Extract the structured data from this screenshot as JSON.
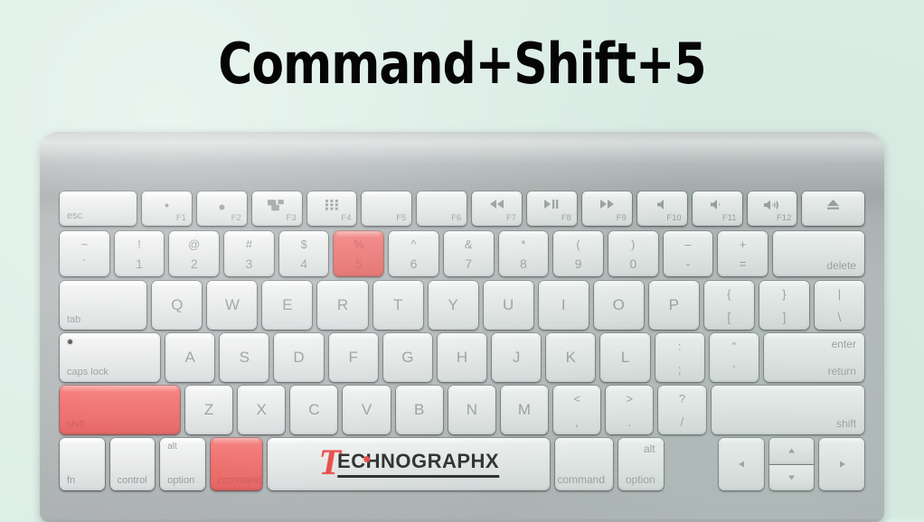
{
  "page": {
    "title": "Command+Shift+5",
    "background_color": "#dceee6",
    "highlight_color": "#ee6361"
  },
  "keyboard": {
    "brand_logo": {
      "lead_letter": "T",
      "text": "ECHNOGRAPHX"
    },
    "rows": {
      "function_row": [
        {
          "name": "esc",
          "label": "esc",
          "icon": "",
          "fkey": ""
        },
        {
          "name": "f1",
          "label": "",
          "icon": "brightness-down-icon",
          "fkey": "F1"
        },
        {
          "name": "f2",
          "label": "",
          "icon": "brightness-up-icon",
          "fkey": "F2"
        },
        {
          "name": "f3",
          "label": "",
          "icon": "mission-control-icon",
          "fkey": "F3"
        },
        {
          "name": "f4",
          "label": "",
          "icon": "launchpad-icon",
          "fkey": "F4"
        },
        {
          "name": "f5",
          "label": "",
          "icon": "",
          "fkey": "F5"
        },
        {
          "name": "f6",
          "label": "",
          "icon": "",
          "fkey": "F6"
        },
        {
          "name": "f7",
          "label": "",
          "icon": "rewind-icon",
          "fkey": "F7"
        },
        {
          "name": "f8",
          "label": "",
          "icon": "play-pause-icon",
          "fkey": "F8"
        },
        {
          "name": "f9",
          "label": "",
          "icon": "fast-forward-icon",
          "fkey": "F9"
        },
        {
          "name": "f10",
          "label": "",
          "icon": "mute-icon",
          "fkey": "F10"
        },
        {
          "name": "f11",
          "label": "",
          "icon": "volume-down-icon",
          "fkey": "F11"
        },
        {
          "name": "f12",
          "label": "",
          "icon": "volume-up-icon",
          "fkey": "F12"
        },
        {
          "name": "eject",
          "label": "",
          "icon": "eject-icon",
          "fkey": ""
        }
      ],
      "number_row": [
        {
          "name": "backtick",
          "upper": "~",
          "lower": "`",
          "highlight": false
        },
        {
          "name": "one",
          "upper": "!",
          "lower": "1",
          "highlight": false
        },
        {
          "name": "two",
          "upper": "@",
          "lower": "2",
          "highlight": false
        },
        {
          "name": "three",
          "upper": "#",
          "lower": "3",
          "highlight": false
        },
        {
          "name": "four",
          "upper": "$",
          "lower": "4",
          "highlight": false
        },
        {
          "name": "five",
          "upper": "%",
          "lower": "5",
          "highlight": true
        },
        {
          "name": "six",
          "upper": "^",
          "lower": "6",
          "highlight": false
        },
        {
          "name": "seven",
          "upper": "&",
          "lower": "7",
          "highlight": false
        },
        {
          "name": "eight",
          "upper": "*",
          "lower": "8",
          "highlight": false
        },
        {
          "name": "nine",
          "upper": "(",
          "lower": "9",
          "highlight": false
        },
        {
          "name": "zero",
          "upper": ")",
          "lower": "0",
          "highlight": false
        },
        {
          "name": "minus",
          "upper": "–",
          "lower": "-",
          "highlight": false
        },
        {
          "name": "equals",
          "upper": "+",
          "lower": "=",
          "highlight": false
        },
        {
          "name": "delete",
          "label": "delete",
          "highlight": false
        }
      ],
      "top_letter_row": {
        "tab": "tab",
        "letters": [
          "Q",
          "W",
          "E",
          "R",
          "T",
          "Y",
          "U",
          "I",
          "O",
          "P"
        ],
        "bracket_left": {
          "upper": "{",
          "lower": "["
        },
        "bracket_right": {
          "upper": "}",
          "lower": "]"
        },
        "backslash": {
          "upper": "|",
          "lower": "\\"
        }
      },
      "home_row": {
        "caps_lock": "caps lock",
        "letters": [
          "A",
          "S",
          "D",
          "F",
          "G",
          "H",
          "J",
          "K",
          "L"
        ],
        "semicolon": {
          "upper": ":",
          "lower": ";"
        },
        "quote": {
          "upper": "\"",
          "lower": "'"
        },
        "return_upper": "enter",
        "return_lower": "return"
      },
      "shift_row": {
        "shift_left": "shift",
        "shift_left_highlight": true,
        "letters": [
          "Z",
          "X",
          "C",
          "V",
          "B",
          "N",
          "M"
        ],
        "comma": {
          "upper": "<",
          "lower": ","
        },
        "period": {
          "upper": ">",
          "lower": "."
        },
        "slash": {
          "upper": "?",
          "lower": "/"
        },
        "shift_right": "shift"
      },
      "bottom_row": {
        "fn": "fn",
        "control": "control",
        "option_left_upper": "alt",
        "option_left_lower": "option",
        "command_left": "command",
        "command_left_highlight": true,
        "command_right": "command",
        "option_right_upper": "alt",
        "option_right_lower": "option",
        "arrow_left": "left-arrow-icon",
        "arrow_up": "up-arrow-icon",
        "arrow_down": "down-arrow-icon",
        "arrow_right": "right-arrow-icon"
      }
    }
  }
}
